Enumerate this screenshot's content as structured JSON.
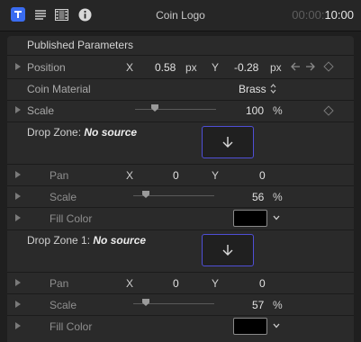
{
  "header": {
    "icons": [
      "text-icon",
      "list-icon",
      "film-icon",
      "info-icon"
    ],
    "title": "Coin Logo",
    "timecode_dim": "00:00:",
    "timecode_main": "10:00"
  },
  "section": {
    "title": "Published Parameters"
  },
  "position": {
    "label": "Position",
    "x_label": "X",
    "x_value": "0.58",
    "x_unit": "px",
    "y_label": "Y",
    "y_value": "-0.28",
    "y_unit": "px"
  },
  "material": {
    "label": "Coin Material",
    "value": "Brass"
  },
  "scale": {
    "label": "Scale",
    "value": "100",
    "unit": "%",
    "slider_fraction": 0.42
  },
  "dropzone": {
    "label": "Drop Zone:",
    "source": "No source",
    "pan": {
      "label": "Pan",
      "x_label": "X",
      "x_value": "0",
      "y_label": "Y",
      "y_value": "0"
    },
    "scale": {
      "label": "Scale",
      "value": "56",
      "unit": "%",
      "slider_fraction": 0.25
    },
    "fill": {
      "label": "Fill Color",
      "color": "#000000"
    }
  },
  "dropzone1": {
    "label": "Drop Zone 1:",
    "source": "No source",
    "pan": {
      "label": "Pan",
      "x_label": "X",
      "x_value": "0",
      "y_label": "Y",
      "y_value": "0"
    },
    "scale": {
      "label": "Scale",
      "value": "57",
      "unit": "%",
      "slider_fraction": 0.25
    },
    "fill": {
      "label": "Fill Color",
      "color": "#000000"
    }
  }
}
